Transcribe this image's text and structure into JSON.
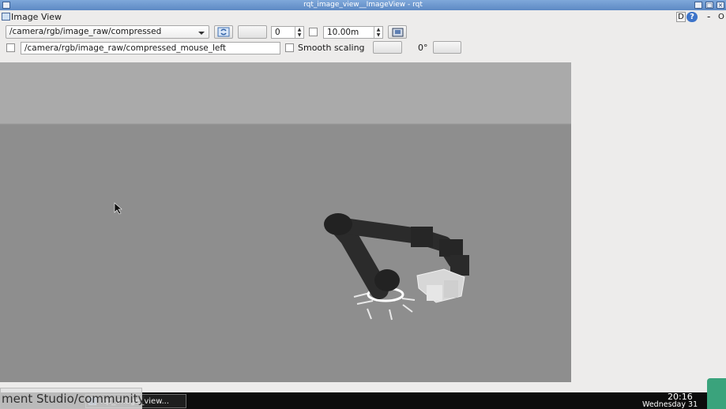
{
  "window": {
    "title": "rqt_image_view__ImageView - rqt",
    "minimize_glyph": "_",
    "maximize_glyph": "□",
    "close_glyph": "×"
  },
  "plugin": {
    "title": "Image View",
    "help_label": "D",
    "help_glyph": "?",
    "dash": "-",
    "close_glyph": "O"
  },
  "toolbar": {
    "topic_value": "/camera/rgb/image_raw/compressed",
    "spin_value": "0",
    "distance_value": "10.00m",
    "mouse_topic_value": "/camera/rgb/image_raw/compressed_mouse_left",
    "smooth_scaling_label": "Smooth scaling",
    "rotation_label": "0°"
  },
  "taskbar": {
    "overlay_text": "ment Studio/community",
    "task_label": "rqt_image_view...",
    "time": "20:16",
    "date": "Wednesday 31"
  },
  "colors": {
    "sky": "#aaaaaa",
    "ground": "#8e8e8e",
    "robot": "#2b2b2b",
    "accent": "#3aa37c"
  }
}
